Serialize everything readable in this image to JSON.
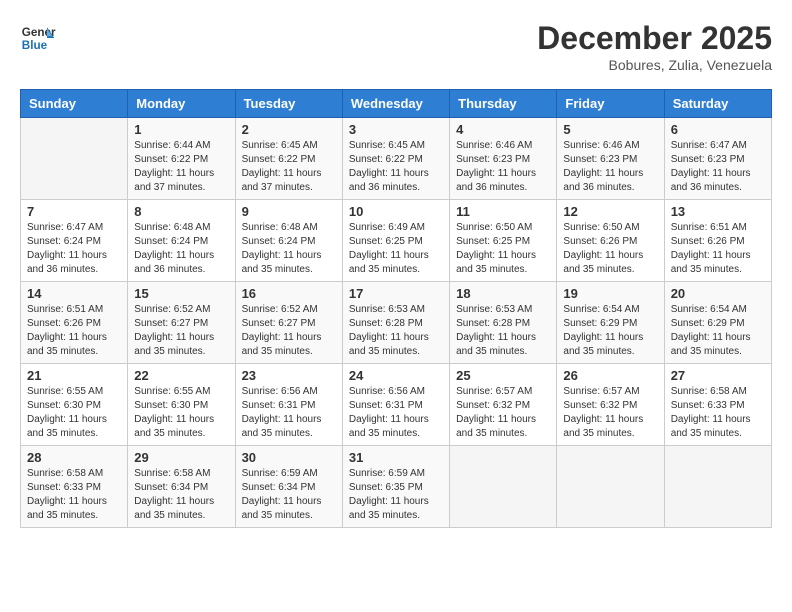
{
  "logo": {
    "line1": "General",
    "line2": "Blue"
  },
  "title": {
    "month_year": "December 2025",
    "location": "Bobures, Zulia, Venezuela"
  },
  "weekdays": [
    "Sunday",
    "Monday",
    "Tuesday",
    "Wednesday",
    "Thursday",
    "Friday",
    "Saturday"
  ],
  "weeks": [
    [
      {
        "day": "",
        "sunrise": "",
        "sunset": "",
        "daylight": ""
      },
      {
        "day": "1",
        "sunrise": "Sunrise: 6:44 AM",
        "sunset": "Sunset: 6:22 PM",
        "daylight": "Daylight: 11 hours and 37 minutes."
      },
      {
        "day": "2",
        "sunrise": "Sunrise: 6:45 AM",
        "sunset": "Sunset: 6:22 PM",
        "daylight": "Daylight: 11 hours and 37 minutes."
      },
      {
        "day": "3",
        "sunrise": "Sunrise: 6:45 AM",
        "sunset": "Sunset: 6:22 PM",
        "daylight": "Daylight: 11 hours and 36 minutes."
      },
      {
        "day": "4",
        "sunrise": "Sunrise: 6:46 AM",
        "sunset": "Sunset: 6:23 PM",
        "daylight": "Daylight: 11 hours and 36 minutes."
      },
      {
        "day": "5",
        "sunrise": "Sunrise: 6:46 AM",
        "sunset": "Sunset: 6:23 PM",
        "daylight": "Daylight: 11 hours and 36 minutes."
      },
      {
        "day": "6",
        "sunrise": "Sunrise: 6:47 AM",
        "sunset": "Sunset: 6:23 PM",
        "daylight": "Daylight: 11 hours and 36 minutes."
      }
    ],
    [
      {
        "day": "7",
        "sunrise": "Sunrise: 6:47 AM",
        "sunset": "Sunset: 6:24 PM",
        "daylight": "Daylight: 11 hours and 36 minutes."
      },
      {
        "day": "8",
        "sunrise": "Sunrise: 6:48 AM",
        "sunset": "Sunset: 6:24 PM",
        "daylight": "Daylight: 11 hours and 36 minutes."
      },
      {
        "day": "9",
        "sunrise": "Sunrise: 6:48 AM",
        "sunset": "Sunset: 6:24 PM",
        "daylight": "Daylight: 11 hours and 35 minutes."
      },
      {
        "day": "10",
        "sunrise": "Sunrise: 6:49 AM",
        "sunset": "Sunset: 6:25 PM",
        "daylight": "Daylight: 11 hours and 35 minutes."
      },
      {
        "day": "11",
        "sunrise": "Sunrise: 6:50 AM",
        "sunset": "Sunset: 6:25 PM",
        "daylight": "Daylight: 11 hours and 35 minutes."
      },
      {
        "day": "12",
        "sunrise": "Sunrise: 6:50 AM",
        "sunset": "Sunset: 6:26 PM",
        "daylight": "Daylight: 11 hours and 35 minutes."
      },
      {
        "day": "13",
        "sunrise": "Sunrise: 6:51 AM",
        "sunset": "Sunset: 6:26 PM",
        "daylight": "Daylight: 11 hours and 35 minutes."
      }
    ],
    [
      {
        "day": "14",
        "sunrise": "Sunrise: 6:51 AM",
        "sunset": "Sunset: 6:26 PM",
        "daylight": "Daylight: 11 hours and 35 minutes."
      },
      {
        "day": "15",
        "sunrise": "Sunrise: 6:52 AM",
        "sunset": "Sunset: 6:27 PM",
        "daylight": "Daylight: 11 hours and 35 minutes."
      },
      {
        "day": "16",
        "sunrise": "Sunrise: 6:52 AM",
        "sunset": "Sunset: 6:27 PM",
        "daylight": "Daylight: 11 hours and 35 minutes."
      },
      {
        "day": "17",
        "sunrise": "Sunrise: 6:53 AM",
        "sunset": "Sunset: 6:28 PM",
        "daylight": "Daylight: 11 hours and 35 minutes."
      },
      {
        "day": "18",
        "sunrise": "Sunrise: 6:53 AM",
        "sunset": "Sunset: 6:28 PM",
        "daylight": "Daylight: 11 hours and 35 minutes."
      },
      {
        "day": "19",
        "sunrise": "Sunrise: 6:54 AM",
        "sunset": "Sunset: 6:29 PM",
        "daylight": "Daylight: 11 hours and 35 minutes."
      },
      {
        "day": "20",
        "sunrise": "Sunrise: 6:54 AM",
        "sunset": "Sunset: 6:29 PM",
        "daylight": "Daylight: 11 hours and 35 minutes."
      }
    ],
    [
      {
        "day": "21",
        "sunrise": "Sunrise: 6:55 AM",
        "sunset": "Sunset: 6:30 PM",
        "daylight": "Daylight: 11 hours and 35 minutes."
      },
      {
        "day": "22",
        "sunrise": "Sunrise: 6:55 AM",
        "sunset": "Sunset: 6:30 PM",
        "daylight": "Daylight: 11 hours and 35 minutes."
      },
      {
        "day": "23",
        "sunrise": "Sunrise: 6:56 AM",
        "sunset": "Sunset: 6:31 PM",
        "daylight": "Daylight: 11 hours and 35 minutes."
      },
      {
        "day": "24",
        "sunrise": "Sunrise: 6:56 AM",
        "sunset": "Sunset: 6:31 PM",
        "daylight": "Daylight: 11 hours and 35 minutes."
      },
      {
        "day": "25",
        "sunrise": "Sunrise: 6:57 AM",
        "sunset": "Sunset: 6:32 PM",
        "daylight": "Daylight: 11 hours and 35 minutes."
      },
      {
        "day": "26",
        "sunrise": "Sunrise: 6:57 AM",
        "sunset": "Sunset: 6:32 PM",
        "daylight": "Daylight: 11 hours and 35 minutes."
      },
      {
        "day": "27",
        "sunrise": "Sunrise: 6:58 AM",
        "sunset": "Sunset: 6:33 PM",
        "daylight": "Daylight: 11 hours and 35 minutes."
      }
    ],
    [
      {
        "day": "28",
        "sunrise": "Sunrise: 6:58 AM",
        "sunset": "Sunset: 6:33 PM",
        "daylight": "Daylight: 11 hours and 35 minutes."
      },
      {
        "day": "29",
        "sunrise": "Sunrise: 6:58 AM",
        "sunset": "Sunset: 6:34 PM",
        "daylight": "Daylight: 11 hours and 35 minutes."
      },
      {
        "day": "30",
        "sunrise": "Sunrise: 6:59 AM",
        "sunset": "Sunset: 6:34 PM",
        "daylight": "Daylight: 11 hours and 35 minutes."
      },
      {
        "day": "31",
        "sunrise": "Sunrise: 6:59 AM",
        "sunset": "Sunset: 6:35 PM",
        "daylight": "Daylight: 11 hours and 35 minutes."
      },
      {
        "day": "",
        "sunrise": "",
        "sunset": "",
        "daylight": ""
      },
      {
        "day": "",
        "sunrise": "",
        "sunset": "",
        "daylight": ""
      },
      {
        "day": "",
        "sunrise": "",
        "sunset": "",
        "daylight": ""
      }
    ]
  ]
}
